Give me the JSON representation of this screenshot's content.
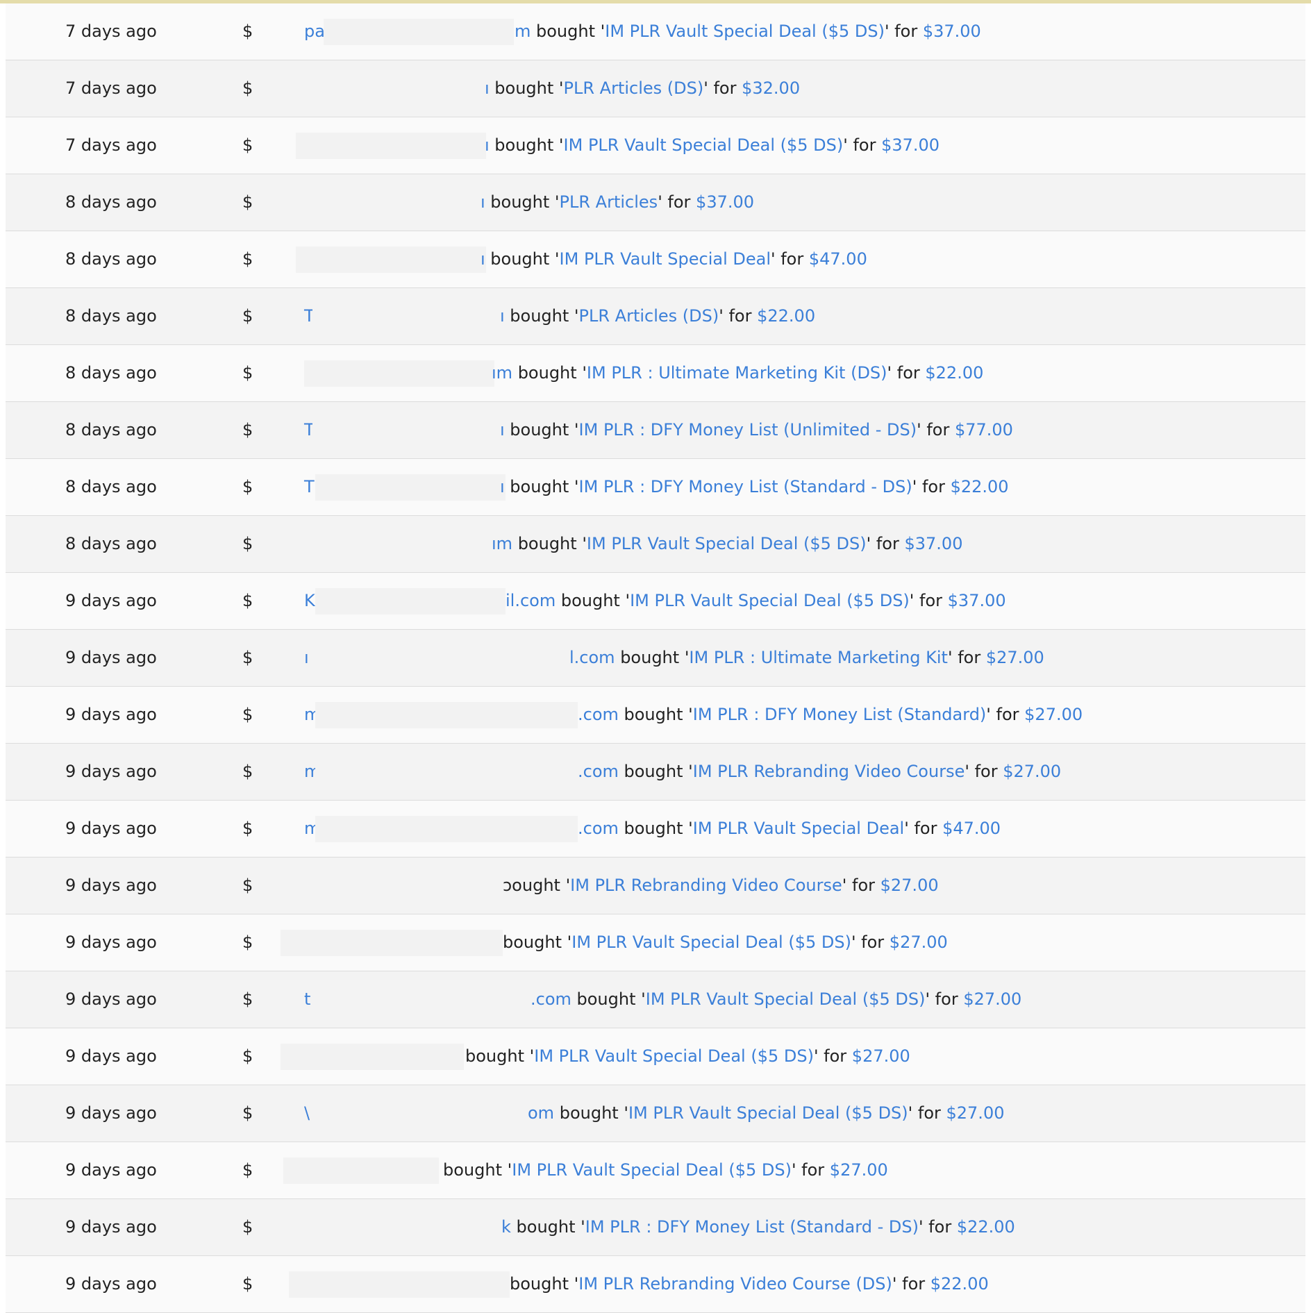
{
  "accent_color": "#e4dcaa",
  "link_color": "#3b7fd8",
  "icons": {
    "dollar": "$"
  },
  "sales": [
    {
      "time": "7 days ago",
      "buyer_start": "pa",
      "buyer_end": "m",
      "verb": "bought",
      "product": "IM PLR Vault Special Deal ($5 DS)",
      "price": "$37.00"
    },
    {
      "time": "7 days ago",
      "buyer_start": "",
      "buyer_end": "ı",
      "verb": "bought",
      "product": "PLR Articles (DS)",
      "price": "$32.00"
    },
    {
      "time": "7 days ago",
      "buyer_start": "",
      "buyer_end": "ı",
      "verb": "bought",
      "product": "IM PLR Vault Special Deal ($5 DS)",
      "price": "$37.00"
    },
    {
      "time": "8 days ago",
      "buyer_start": "",
      "buyer_end": "ı",
      "verb": "bought",
      "product": "PLR Articles",
      "price": "$37.00"
    },
    {
      "time": "8 days ago",
      "buyer_start": "",
      "buyer_end": "ı",
      "verb": "bought",
      "product": "IM PLR Vault Special Deal",
      "price": "$47.00"
    },
    {
      "time": "8 days ago",
      "buyer_start": "T",
      "buyer_end": "ı",
      "verb": "bought",
      "product": "PLR Articles (DS)",
      "price": "$22.00"
    },
    {
      "time": "8 days ago",
      "buyer_start": "",
      "buyer_end": "ım",
      "verb": "bought",
      "product": "IM PLR : Ultimate Marketing Kit (DS)",
      "price": "$22.00"
    },
    {
      "time": "8 days ago",
      "buyer_start": "T",
      "buyer_end": "ı",
      "verb": "bought",
      "product": "IM PLR : DFY Money List (Unlimited - DS)",
      "price": "$77.00"
    },
    {
      "time": "8 days ago",
      "buyer_start": "T",
      "buyer_end": "ı",
      "verb": "bought",
      "product": "IM PLR : DFY Money List (Standard - DS)",
      "price": "$22.00"
    },
    {
      "time": "8 days ago",
      "buyer_start": "",
      "buyer_end": "ım",
      "verb": "bought",
      "product": "IM PLR Vault Special Deal ($5 DS)",
      "price": "$37.00"
    },
    {
      "time": "9 days ago",
      "buyer_start": "K",
      "buyer_end": "il.com",
      "verb": "bought",
      "product": "IM PLR Vault Special Deal ($5 DS)",
      "price": "$37.00"
    },
    {
      "time": "9 days ago",
      "buyer_start": "ı",
      "buyer_end": "l.com",
      "verb": "bought",
      "product": "IM PLR : Ultimate Marketing Kit",
      "price": "$27.00"
    },
    {
      "time": "9 days ago",
      "buyer_start": "m",
      "buyer_end": ".com",
      "verb": "bought",
      "product": "IM PLR : DFY Money List (Standard)",
      "price": "$27.00"
    },
    {
      "time": "9 days ago",
      "buyer_start": "m",
      "buyer_end": ".com",
      "verb": "bought",
      "product": "IM PLR Rebranding Video Course",
      "price": "$27.00"
    },
    {
      "time": "9 days ago",
      "buyer_start": "m",
      "buyer_end": ".com",
      "verb": "bought",
      "product": "IM PLR Vault Special Deal",
      "price": "$47.00"
    },
    {
      "time": "9 days ago",
      "buyer_start": "",
      "buyer_end": "",
      "verb": "ɔought",
      "product": "IM PLR Rebranding Video Course",
      "price": "$27.00"
    },
    {
      "time": "9 days ago",
      "buyer_start": "",
      "buyer_end": "",
      "verb": "bought",
      "product": "IM PLR Vault Special Deal ($5 DS)",
      "price": "$27.00"
    },
    {
      "time": "9 days ago",
      "buyer_start": "t",
      "buyer_end": ".com",
      "verb": "bought",
      "product": "IM PLR Vault Special Deal ($5 DS)",
      "price": "$27.00"
    },
    {
      "time": "9 days ago",
      "buyer_start": "",
      "buyer_end": "",
      "verb": "bought",
      "product": "IM PLR Vault Special Deal ($5 DS)",
      "price": "$27.00"
    },
    {
      "time": "9 days ago",
      "buyer_start": "\\",
      "buyer_end": "om",
      "verb": "bought",
      "product": "IM PLR Vault Special Deal ($5 DS)",
      "price": "$27.00"
    },
    {
      "time": "9 days ago",
      "buyer_start": "",
      "buyer_end": "",
      "verb": "bought",
      "product": "IM PLR Vault Special Deal ($5 DS)",
      "price": "$27.00"
    },
    {
      "time": "9 days ago",
      "buyer_start": "",
      "buyer_end": "k",
      "verb": "bought",
      "product": "IM PLR : DFY Money List (Standard - DS)",
      "price": "$22.00"
    },
    {
      "time": "9 days ago",
      "buyer_start": "",
      "buyer_end": "",
      "verb": "bought",
      "product": "IM PLR Rebranding Video Course (DS)",
      "price": "$22.00"
    }
  ]
}
